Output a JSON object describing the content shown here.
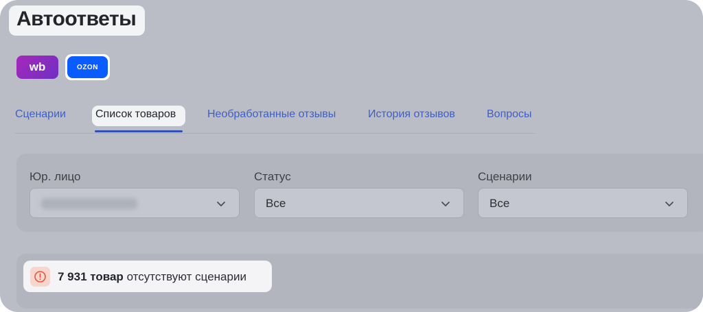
{
  "page": {
    "title": "Автоответы"
  },
  "marketplaces": [
    {
      "label": "wb",
      "brand_color": "#8a2bc2",
      "selected": false
    },
    {
      "label": "OZON",
      "brand_color": "#0a5cff",
      "selected": true
    }
  ],
  "tabs": [
    {
      "label": "Сценарии",
      "active": false
    },
    {
      "label": "Список товаров",
      "active": true
    },
    {
      "label": "Необработанные отзывы",
      "active": false
    },
    {
      "label": "История отзывов",
      "active": false
    },
    {
      "label": "Вопросы",
      "active": false
    }
  ],
  "filters": {
    "legal_entity": {
      "label": "Юр. лицо",
      "value_blurred": true
    },
    "status": {
      "label": "Статус",
      "value": "Все"
    },
    "scenarios": {
      "label": "Сценарии",
      "value": "Все"
    }
  },
  "notice": {
    "icon": "alert-circle-icon",
    "count_text": "7 931 товар",
    "message": "отсутствуют сценарии",
    "icon_color": "#e0573f"
  },
  "colors": {
    "accent": "#2f4fb8",
    "tab_text": "#3f5fc4"
  }
}
